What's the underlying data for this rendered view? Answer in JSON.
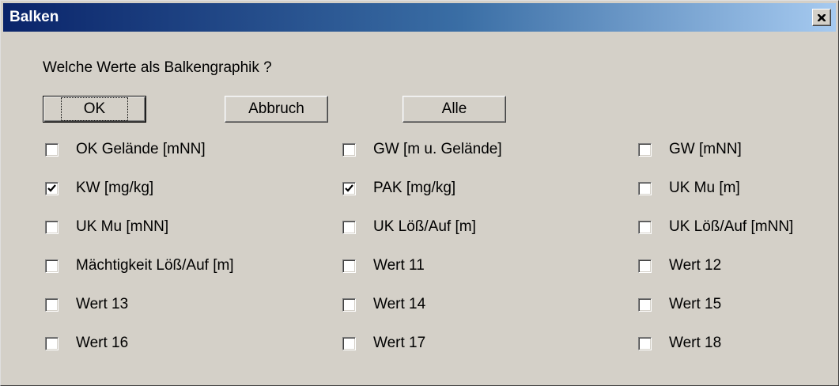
{
  "window": {
    "title": "Balken",
    "close_icon": "close-icon"
  },
  "prompt": "Welche Werte als Balkengraphik ?",
  "buttons": {
    "ok": "OK",
    "cancel": "Abbruch",
    "all": "Alle"
  },
  "options": [
    {
      "label": "OK Gelände [mNN]",
      "checked": false
    },
    {
      "label": "GW [m u. Gelände]",
      "checked": false
    },
    {
      "label": "GW [mNN]",
      "checked": false
    },
    {
      "label": "KW [mg/kg]",
      "checked": true
    },
    {
      "label": "PAK [mg/kg]",
      "checked": true
    },
    {
      "label": "UK Mu [m]",
      "checked": false
    },
    {
      "label": "UK Mu [mNN]",
      "checked": false
    },
    {
      "label": "UK Löß/Auf [m]",
      "checked": false
    },
    {
      "label": "UK Löß/Auf [mNN]",
      "checked": false
    },
    {
      "label": "Mächtigkeit Löß/Auf [m]",
      "checked": false
    },
    {
      "label": "Wert 11",
      "checked": false
    },
    {
      "label": "Wert 12",
      "checked": false
    },
    {
      "label": "Wert 13",
      "checked": false
    },
    {
      "label": "Wert 14",
      "checked": false
    },
    {
      "label": "Wert 15",
      "checked": false
    },
    {
      "label": "Wert 16",
      "checked": false
    },
    {
      "label": "Wert 17",
      "checked": false
    },
    {
      "label": "Wert 18",
      "checked": false
    }
  ]
}
